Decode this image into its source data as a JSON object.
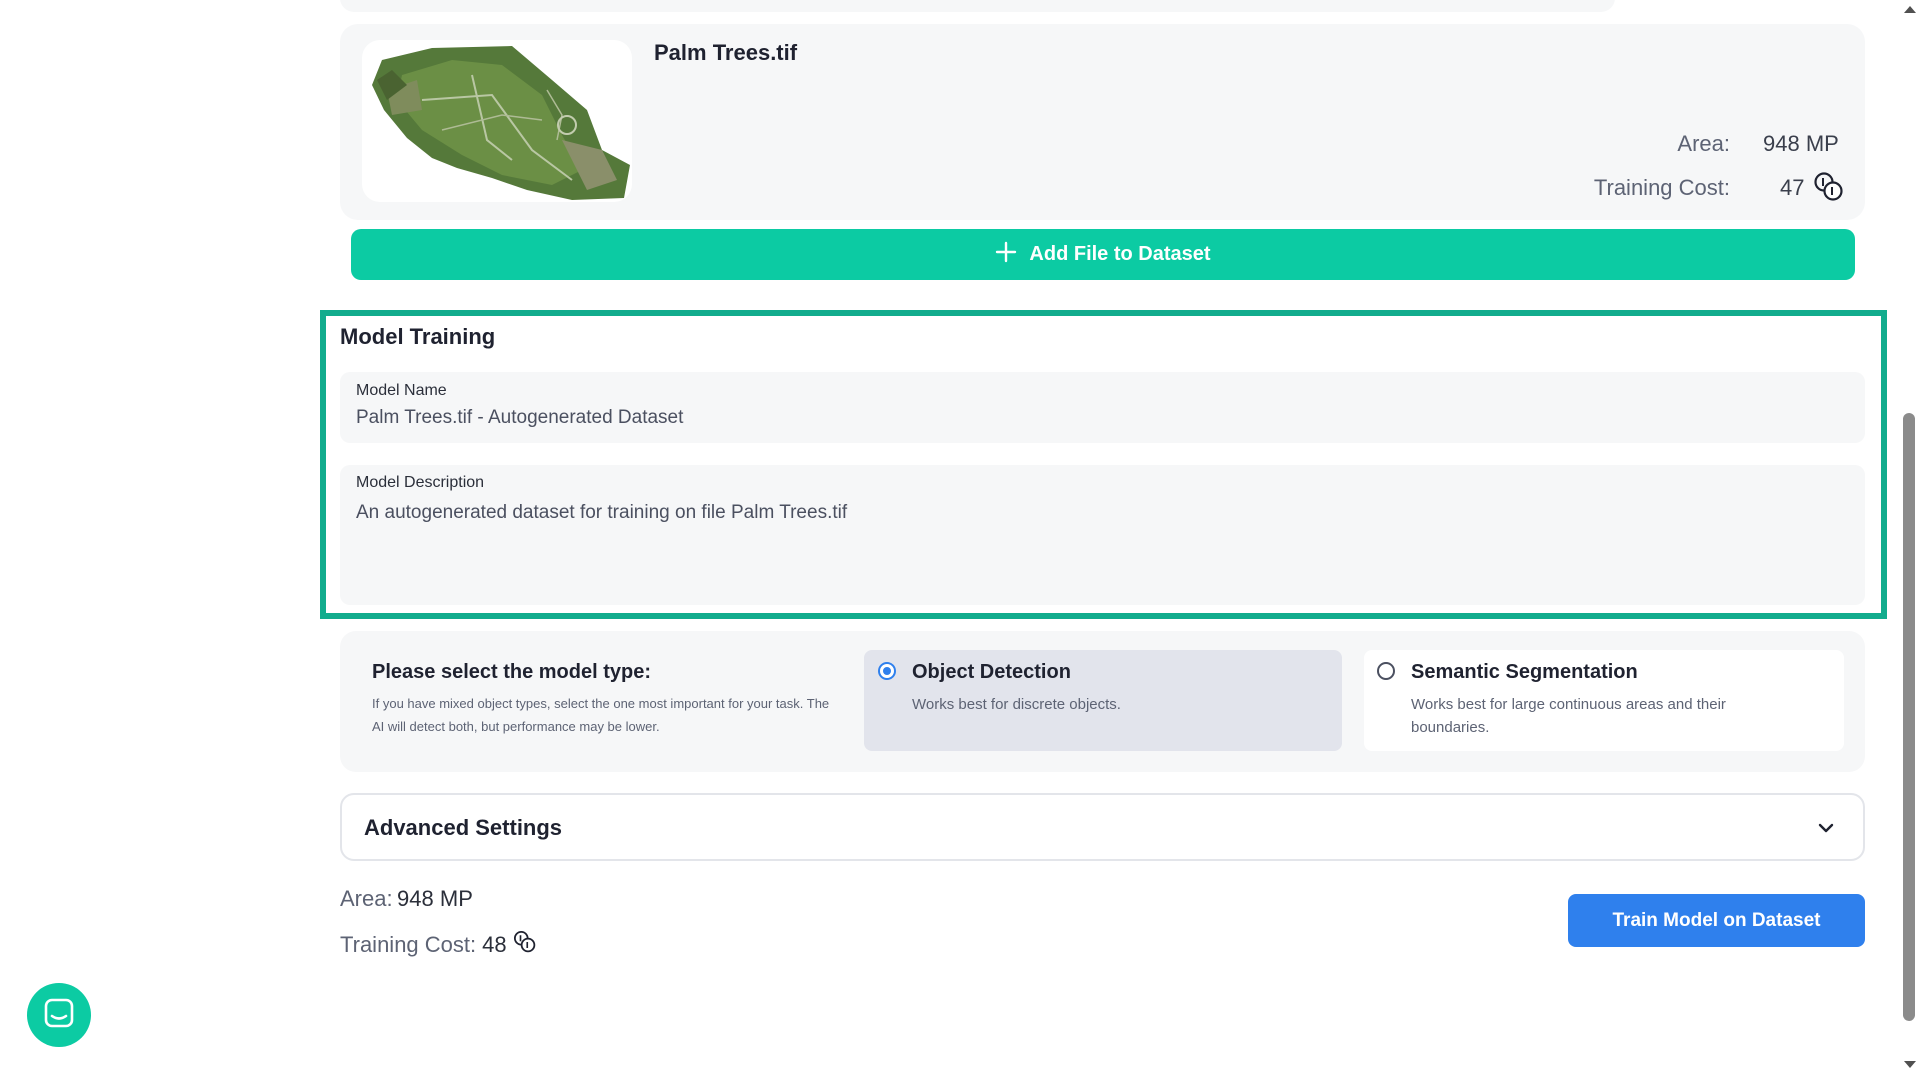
{
  "file": {
    "name": "Palm Trees.tif",
    "area_label": "Area:",
    "area_value": "948 MP",
    "cost_label": "Training Cost:",
    "cost_value": "47"
  },
  "add_file_button": "Add File to Dataset",
  "model_training": {
    "title": "Model Training",
    "name_label": "Model Name",
    "name_value": "Palm Trees.tif - Autogenerated Dataset",
    "desc_label": "Model Description",
    "desc_value": "An autogenerated dataset for training on file Palm Trees.tif"
  },
  "model_type": {
    "title": "Please select the model type:",
    "help": "If you have mixed object types, select the one most important for your task. The AI will detect both, but performance may be lower.",
    "options": [
      {
        "title": "Object Detection",
        "desc": "Works best for discrete objects.",
        "selected": true
      },
      {
        "title": "Semantic Segmentation",
        "desc": "Works best for large continuous areas and their boundaries.",
        "selected": false
      }
    ]
  },
  "advanced_settings": "Advanced Settings",
  "summary": {
    "area_label": "Area:",
    "area_value": "948 MP",
    "cost_label": "Training Cost:",
    "cost_value": "48"
  },
  "train_button": "Train Model on Dataset",
  "colors": {
    "accent_green": "#0ccba3",
    "highlight_border": "#12ac8d",
    "primary_blue": "#2f80ed"
  },
  "icons": [
    "plus-icon",
    "coin-icon",
    "chevron-down-icon",
    "chat-icon",
    "scroll-up-arrow-icon",
    "scroll-down-arrow-icon"
  ]
}
